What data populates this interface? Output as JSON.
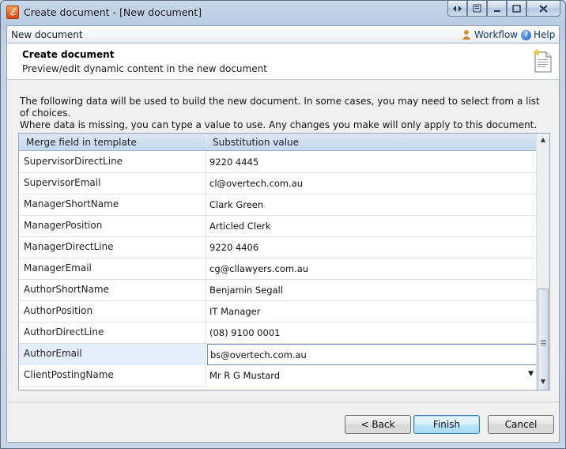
{
  "window": {
    "title": "Create document - [New document]",
    "app_icon_letter": "ℰ"
  },
  "topbar": {
    "label": "New document",
    "workflow_label": "Workflow",
    "help_label": "Help"
  },
  "header": {
    "title": "Create document",
    "subtitle": "Preview/edit dynamic content in the new document"
  },
  "description": {
    "line1": "The following data will be used to build the new document. In some cases, you may need to select from a list of choices.",
    "line2": "Where data is missing, you can type a value to use. Any changes you make will only apply to this document."
  },
  "grid": {
    "columns": [
      "Merge field in template",
      "Substitution value"
    ],
    "rows": [
      {
        "field": "SupervisorDirectLine",
        "value": "9220 4445"
      },
      {
        "field": "SupervisorEmail",
        "value": "cl@overtech.com.au"
      },
      {
        "field": "ManagerShortName",
        "value": "Clark Green"
      },
      {
        "field": "ManagerPosition",
        "value": "Articled Clerk"
      },
      {
        "field": "ManagerDirectLine",
        "value": "9220 4406"
      },
      {
        "field": "ManagerEmail",
        "value": "cg@cllawyers.com.au"
      },
      {
        "field": "AuthorShortName",
        "value": "Benjamin Segall"
      },
      {
        "field": "AuthorPosition",
        "value": "IT Manager"
      },
      {
        "field": "AuthorDirectLine",
        "value": "(08) 9100 0001"
      },
      {
        "field": "AuthorEmail",
        "value": "bs@overtech.com.au"
      },
      {
        "field": "ClientPostingName",
        "value": "Mr R G Mustard"
      }
    ]
  },
  "buttons": {
    "back": "< Back",
    "finish": "Finish",
    "cancel": "Cancel"
  },
  "colors": {
    "accent": "#3c7fb1",
    "header_bg": "#c4d6ee",
    "selection": "#e4eefb"
  }
}
